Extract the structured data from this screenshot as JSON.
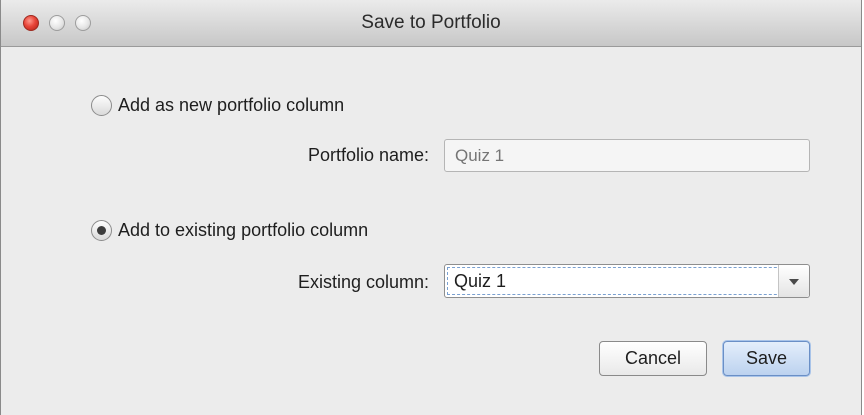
{
  "window": {
    "title": "Save to Portfolio"
  },
  "options": {
    "new_column": {
      "label": "Add as new portfolio column",
      "selected": false
    },
    "existing_column": {
      "label": "Add to existing portfolio column",
      "selected": true
    }
  },
  "portfolio_name": {
    "label": "Portfolio name:",
    "placeholder": "Quiz 1",
    "enabled": false
  },
  "existing_column_select": {
    "label": "Existing column:",
    "value": "Quiz 1"
  },
  "buttons": {
    "cancel": "Cancel",
    "save": "Save"
  },
  "colors": {
    "close_button": "#e8463a",
    "default_button": "#bcd2ef",
    "focus_ring": "#7aa0d0"
  }
}
